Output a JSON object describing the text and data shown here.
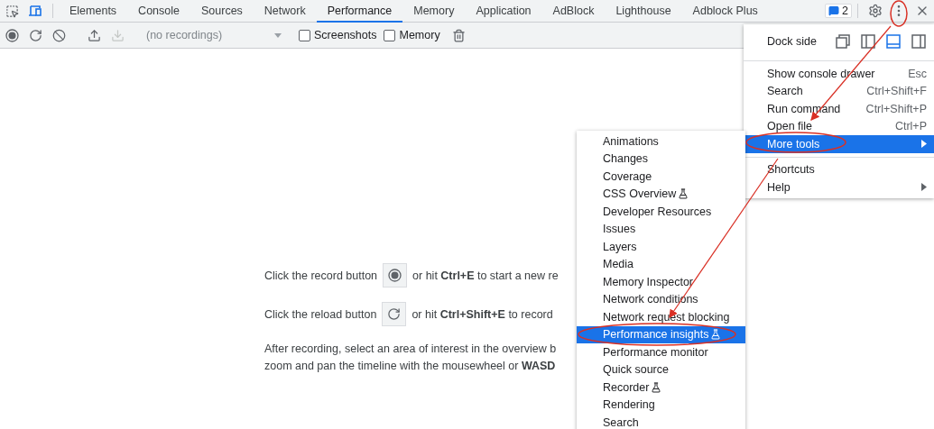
{
  "tabs": [
    {
      "label": "Elements",
      "selected": false
    },
    {
      "label": "Console",
      "selected": false
    },
    {
      "label": "Sources",
      "selected": false
    },
    {
      "label": "Network",
      "selected": false
    },
    {
      "label": "Performance",
      "selected": true
    },
    {
      "label": "Memory",
      "selected": false
    },
    {
      "label": "Application",
      "selected": false
    },
    {
      "label": "AdBlock",
      "selected": false
    },
    {
      "label": "Lighthouse",
      "selected": false
    },
    {
      "label": "Adblock Plus",
      "selected": false
    }
  ],
  "issues_badge": "2",
  "toolbar": {
    "recording_select": {
      "placeholder": "(no recordings)"
    },
    "download_disabled": true,
    "checkboxes": [
      {
        "label": "Screenshots",
        "checked": false
      },
      {
        "label": "Memory",
        "checked": false
      }
    ]
  },
  "hints": {
    "record_line": {
      "before": "Click the record button",
      "after": "or hit **Ctrl+E** to start a new re"
    },
    "reload_line": {
      "before": "Click the reload button",
      "after": "or hit **Ctrl+Shift+E** to record"
    },
    "lines": [
      "After recording, select an area of interest in the overview b",
      "zoom and pan the timeline with the mousewheel or **WASD**"
    ]
  },
  "main_menu": {
    "dock_side": {
      "label": "Dock side",
      "options": [
        {
          "kind": "undock",
          "selected": false
        },
        {
          "kind": "left",
          "selected": false
        },
        {
          "kind": "bottom",
          "selected": true
        },
        {
          "kind": "right",
          "selected": false
        }
      ]
    },
    "groups": [
      [
        {
          "label": "Show console drawer",
          "shortcut": "Esc",
          "submenu": false,
          "selected": false
        },
        {
          "label": "Search",
          "shortcut": "Ctrl+Shift+F",
          "submenu": false,
          "selected": false
        },
        {
          "label": "Run command",
          "shortcut": "Ctrl+Shift+P",
          "submenu": false,
          "selected": false
        },
        {
          "label": "Open file",
          "shortcut": "Ctrl+P",
          "submenu": false,
          "selected": false
        },
        {
          "label": "More tools",
          "submenu": true,
          "selected": true
        }
      ],
      [
        {
          "label": "Shortcuts",
          "submenu": false,
          "selected": false
        },
        {
          "label": "Help",
          "submenu": true,
          "selected": false
        }
      ]
    ]
  },
  "more_tools_menu": [
    {
      "label": "Animations",
      "experimental": false,
      "selected": false
    },
    {
      "label": "Changes",
      "experimental": false,
      "selected": false
    },
    {
      "label": "Coverage",
      "experimental": false,
      "selected": false
    },
    {
      "label": "CSS Overview",
      "experimental": true,
      "selected": false
    },
    {
      "label": "Developer Resources",
      "experimental": false,
      "selected": false
    },
    {
      "label": "Issues",
      "experimental": false,
      "selected": false
    },
    {
      "label": "Layers",
      "experimental": false,
      "selected": false
    },
    {
      "label": "Media",
      "experimental": false,
      "selected": false
    },
    {
      "label": "Memory Inspector",
      "experimental": false,
      "selected": false
    },
    {
      "label": "Network conditions",
      "experimental": false,
      "selected": false
    },
    {
      "label": "Network request blocking",
      "experimental": false,
      "selected": false
    },
    {
      "label": "Performance insights",
      "experimental": true,
      "selected": true
    },
    {
      "label": "Performance monitor",
      "experimental": false,
      "selected": false
    },
    {
      "label": "Quick source",
      "experimental": false,
      "selected": false
    },
    {
      "label": "Recorder",
      "experimental": true,
      "selected": false
    },
    {
      "label": "Rendering",
      "experimental": false,
      "selected": false
    },
    {
      "label": "Search",
      "experimental": false,
      "selected": false
    }
  ]
}
